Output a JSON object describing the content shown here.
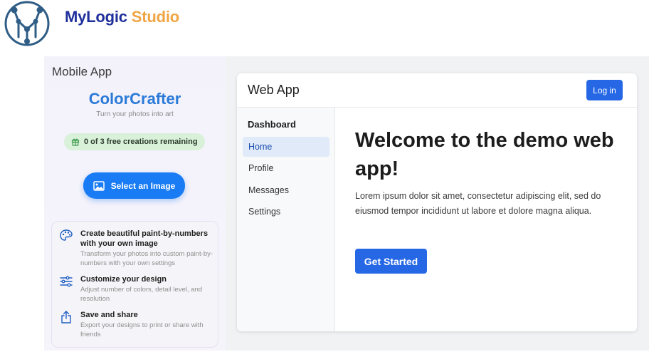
{
  "brand": {
    "name_part1": "MyLogic",
    "name_part2": "Studio",
    "primary_color": "#1f2f9b",
    "accent_color": "#f0a545",
    "logo_icon": "network-nodes-logo"
  },
  "mobile": {
    "section_title": "Mobile App",
    "app_name": "ColorCrafter",
    "tagline": "Turn your photos into art",
    "credits": {
      "icon": "gift-icon",
      "text": "0 of 3 free creations remaining"
    },
    "select_button": {
      "icon": "image-icon",
      "label": "Select an Image"
    },
    "features": [
      {
        "icon": "palette-icon",
        "title": "Create beautiful paint-by-numbers with your own image",
        "description": "Transform your photos into custom paint-by-numbers with your own settings"
      },
      {
        "icon": "sliders-icon",
        "title": "Customize your design",
        "description": "Adjust number of colors, detail level, and resolution"
      },
      {
        "icon": "share-icon",
        "title": "Save and share",
        "description": "Export your designs to print or share with friends"
      }
    ],
    "accent_color": "#1a7cf4"
  },
  "web": {
    "title": "Web App",
    "login_label": "Log in",
    "sidebar_heading": "Dashboard",
    "sidebar_items": [
      {
        "label": "Home",
        "active": true
      },
      {
        "label": "Profile",
        "active": false
      },
      {
        "label": "Messages",
        "active": false
      },
      {
        "label": "Settings",
        "active": false
      }
    ],
    "welcome_heading": "Welcome to the demo web app!",
    "body_text": "Lorem ipsum dolor sit amet, consectetur adipiscing elit, sed do eiusmod tempor incididunt ut labore et dolore magna aliqua.",
    "cta_label": "Get Started",
    "accent_color": "#2567e5"
  }
}
